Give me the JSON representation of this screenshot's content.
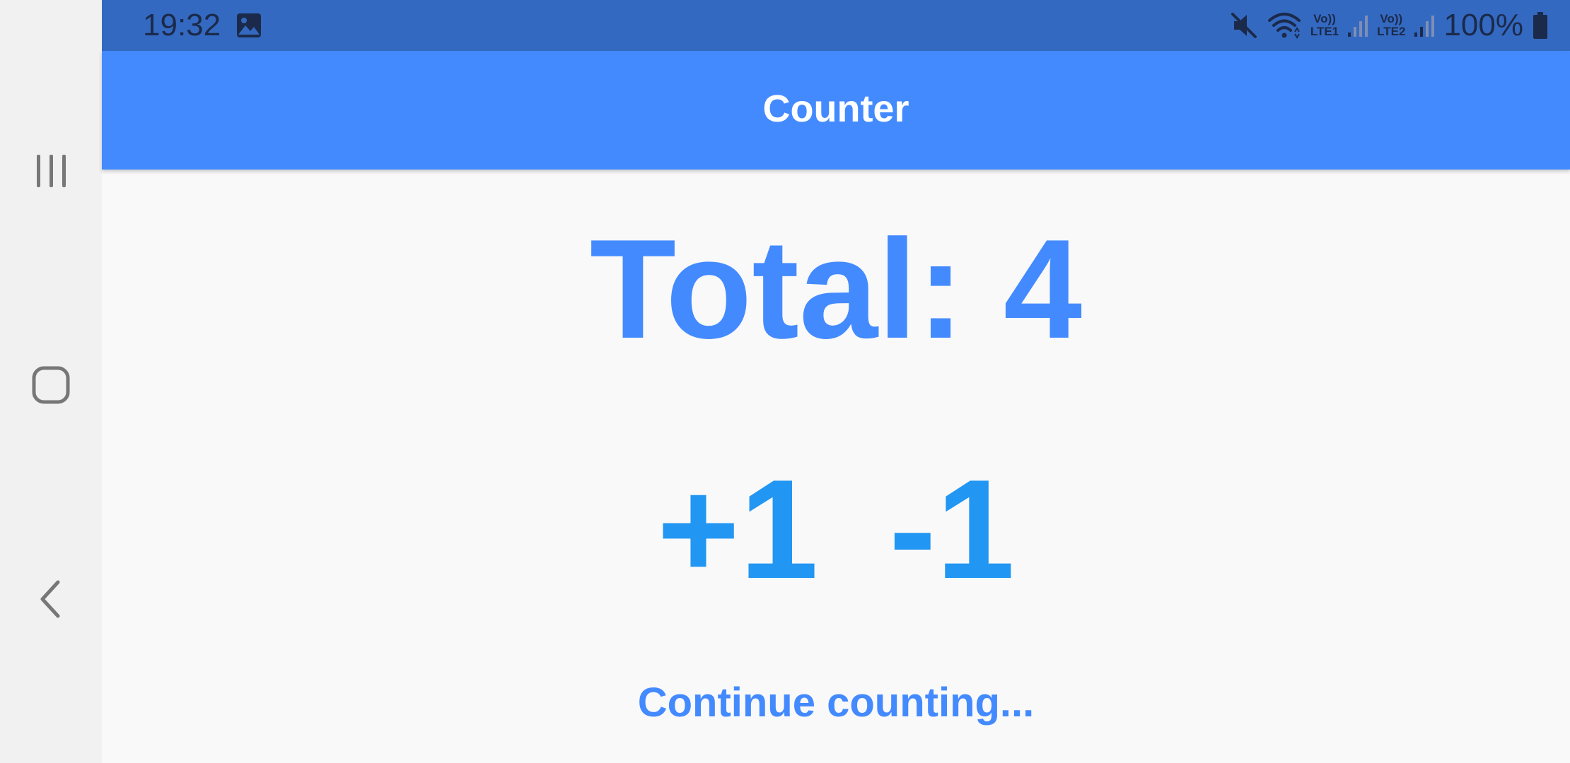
{
  "status_bar": {
    "time": "19:32",
    "battery_percent": "100%",
    "sim1_label_top": "Vo))",
    "sim1_label_bottom": "LTE1",
    "sim2_label_top": "Vo))",
    "sim2_label_bottom": "LTE2",
    "icons": [
      "gallery-icon",
      "mute-icon",
      "wifi-icon",
      "signal-icon",
      "signal-icon",
      "battery-icon"
    ]
  },
  "nav_bar": {
    "icons": [
      "recents-icon",
      "home-icon",
      "back-icon"
    ]
  },
  "app_bar": {
    "title": "Counter"
  },
  "counter": {
    "total_label": "Total: 4",
    "increment_label": "+1",
    "decrement_label": "-1",
    "continue_label": "Continue counting..."
  },
  "colors": {
    "status_bar": "#3469c1",
    "app_bar": "#448aff",
    "total_text": "#448aff",
    "buttons_text": "#2196f3",
    "background": "#f9f9f9",
    "nav_rail": "#f1f1f1"
  }
}
